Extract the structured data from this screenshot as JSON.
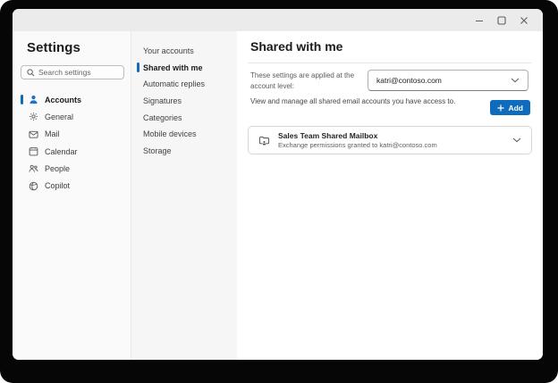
{
  "colors": {
    "accent": "#0f6cbd",
    "titlebar": "#ebebeb",
    "sidebar_bg": "#fafafa",
    "subnav_bg": "#f6f6f6"
  },
  "window": {
    "controls": {
      "minimize": "minimize-icon",
      "maximize": "maximize-icon",
      "close": "close-icon"
    }
  },
  "sidebar": {
    "title": "Settings",
    "search": {
      "placeholder": "Search settings",
      "icon": "search-icon"
    },
    "items": [
      {
        "label": "Accounts",
        "icon": "person-icon",
        "selected": true
      },
      {
        "label": "General",
        "icon": "gear-icon",
        "selected": false
      },
      {
        "label": "Mail",
        "icon": "mail-icon",
        "selected": false
      },
      {
        "label": "Calendar",
        "icon": "calendar-icon",
        "selected": false
      },
      {
        "label": "People",
        "icon": "people-icon",
        "selected": false
      },
      {
        "label": "Copilot",
        "icon": "copilot-icon",
        "selected": false
      }
    ]
  },
  "subnav": {
    "items": [
      {
        "label": "Your accounts",
        "selected": false
      },
      {
        "label": "Shared with me",
        "selected": true
      },
      {
        "label": "Automatic replies",
        "selected": false
      },
      {
        "label": "Signatures",
        "selected": false
      },
      {
        "label": "Categories",
        "selected": false
      },
      {
        "label": "Mobile devices",
        "selected": false
      },
      {
        "label": "Storage",
        "selected": false
      }
    ]
  },
  "main": {
    "title": "Shared with me",
    "scope_label": "These settings are applied at the account level:",
    "account_dropdown": {
      "value": "katri@contoso.com"
    },
    "description": "View and manage all shared email accounts you have access to.",
    "add_button": {
      "label": "Add",
      "icon": "plus-icon"
    },
    "mailboxes": [
      {
        "name": "Sales Team Shared Mailbox",
        "detail": "Exchange permissions granted to katri@contoso.com",
        "icon": "shared-mailbox-icon"
      }
    ]
  }
}
